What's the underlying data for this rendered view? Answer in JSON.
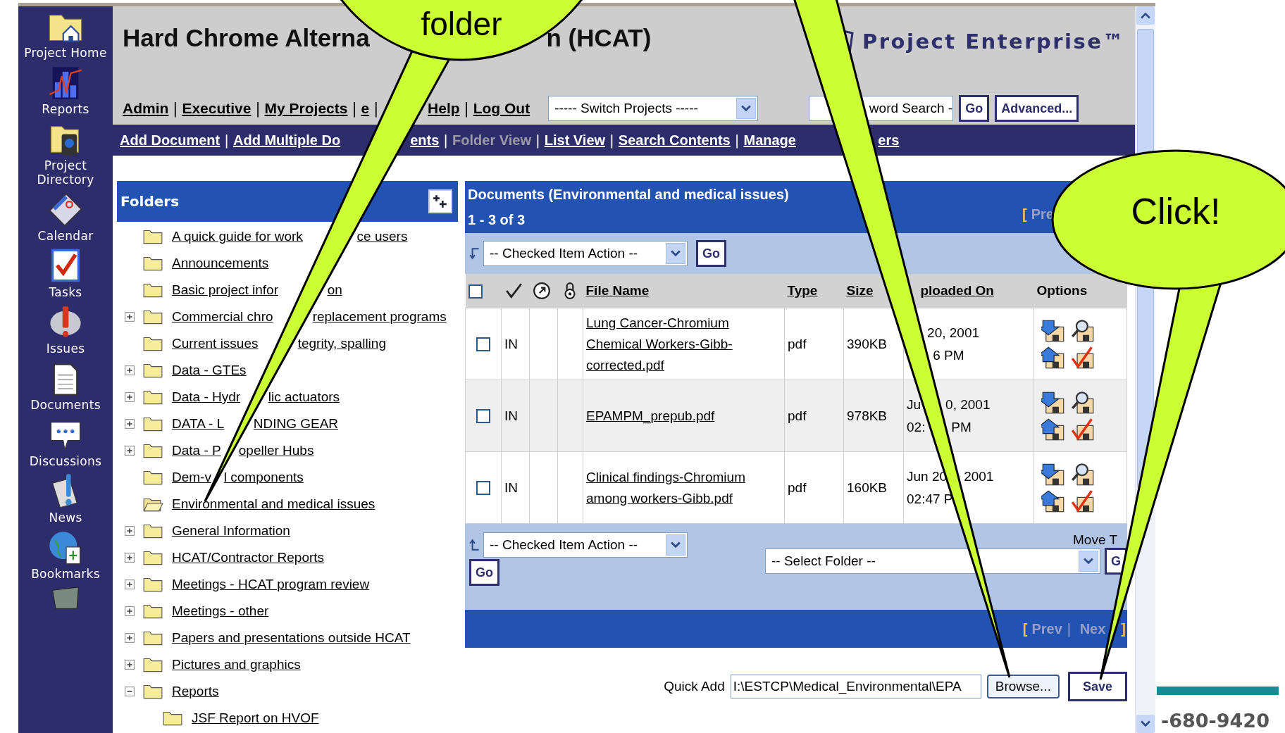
{
  "sidebar": {
    "items": [
      {
        "kind": "home",
        "label": "Project Home"
      },
      {
        "kind": "reports",
        "label": "Reports"
      },
      {
        "kind": "directory",
        "label": "Project Directory"
      },
      {
        "kind": "calendar",
        "label": "Calendar"
      },
      {
        "kind": "tasks",
        "label": "Tasks"
      },
      {
        "kind": "issues",
        "label": "Issues"
      },
      {
        "kind": "documents",
        "label": "Documents"
      },
      {
        "kind": "discussions",
        "label": "Discussions"
      },
      {
        "kind": "news",
        "label": "News"
      },
      {
        "kind": "bookmarks",
        "label": "Bookmarks"
      },
      {
        "kind": "box"
      }
    ]
  },
  "header": {
    "title_parts": [
      "Hard Chrome Alterna",
      "n (HCAT)"
    ],
    "logo": "Project Enterprise™",
    "nav_separator": "|",
    "nav_links": [
      {
        "label": "Admin"
      },
      {
        "label": "Executive"
      },
      {
        "label": "My Projects"
      },
      {
        "label": "e"
      },
      {
        "label": "Help"
      },
      {
        "label": "Log Out"
      }
    ],
    "switch_projects": "----- Switch Projects -----",
    "keyword_search": "word Search -",
    "go": "Go",
    "advanced": "Advanced..."
  },
  "subnav": {
    "separator": "|",
    "links": [
      {
        "parts": [
          "Add Document"
        ],
        "selected": false
      },
      {
        "parts": [
          "Add Multiple Do",
          "ents"
        ],
        "selected": false
      },
      {
        "parts": [
          "Folder View"
        ],
        "selected": true
      },
      {
        "parts": [
          "List View"
        ],
        "selected": false
      },
      {
        "parts": [
          "Search Contents"
        ],
        "selected": false
      },
      {
        "parts": [
          "Manage",
          "ers"
        ],
        "selected": false
      }
    ]
  },
  "folders": {
    "title": "Folders",
    "items": [
      {
        "parts": [
          "A quick guide for work",
          "ce users"
        ],
        "expandable": false,
        "selected": false
      },
      {
        "parts": [
          "Announcements"
        ],
        "expandable": false,
        "selected": false
      },
      {
        "parts": [
          "Basic project infor",
          "on"
        ],
        "expandable": false,
        "selected": false
      },
      {
        "parts": [
          "Commercial chro",
          "replacement programs"
        ],
        "expandable": true,
        "expanded": false,
        "selected": false
      },
      {
        "parts": [
          "Current issues",
          "tegrity, spalling"
        ],
        "expandable": false,
        "selected": false
      },
      {
        "parts": [
          "Data - GTEs"
        ],
        "expandable": true,
        "expanded": false,
        "selected": false
      },
      {
        "parts": [
          "Data - Hydr",
          "lic actuators"
        ],
        "expandable": true,
        "expanded": false,
        "selected": false
      },
      {
        "parts": [
          "DATA - L",
          "NDING GEAR"
        ],
        "expandable": true,
        "expanded": false,
        "selected": false
      },
      {
        "parts": [
          "Data - P",
          "opeller Hubs"
        ],
        "expandable": true,
        "expanded": false,
        "selected": false
      },
      {
        "parts": [
          "Dem-v",
          "l components"
        ],
        "expandable": false,
        "selected": false
      },
      {
        "parts": [
          "Environmental and medical issues"
        ],
        "expandable": false,
        "selected": true
      },
      {
        "parts": [
          "General Information"
        ],
        "expandable": true,
        "expanded": false,
        "selected": false
      },
      {
        "parts": [
          "HCAT/Contractor Reports"
        ],
        "expandable": true,
        "expanded": false,
        "selected": false
      },
      {
        "parts": [
          "Meetings - HCAT program review"
        ],
        "expandable": true,
        "expanded": false,
        "selected": false
      },
      {
        "parts": [
          "Meetings - other"
        ],
        "expandable": true,
        "expanded": false,
        "selected": false
      },
      {
        "parts": [
          "Papers and presentations outside HCAT"
        ],
        "expandable": true,
        "expanded": false,
        "selected": false
      },
      {
        "parts": [
          "Pictures and graphics"
        ],
        "expandable": true,
        "expanded": false,
        "selected": false
      },
      {
        "parts": [
          "Reports"
        ],
        "expandable": true,
        "expanded": true,
        "selected": false,
        "children": [
          {
            "parts": [
              "JSF Report on HVOF"
            ],
            "expandable": false,
            "selected": false
          }
        ]
      }
    ]
  },
  "documents": {
    "title": "Documents (Environmental and medical issues) 1 - 3 of 3",
    "pager_top": {
      "open": "[",
      "prev": "Pre"
    },
    "action_select": "-- Checked Item Action --",
    "go": "Go",
    "columns": [
      {
        "kind": "select_all",
        "checked": false
      },
      {
        "kind": "icon"
      },
      {
        "kind": "icon"
      },
      {
        "kind": "icon"
      },
      {
        "kind": "text",
        "label": "File Name",
        "sortable": true,
        "covered_before": false
      },
      {
        "kind": "text",
        "label": "Type",
        "sortable": true,
        "covered_before": false
      },
      {
        "kind": "text",
        "label": "Size",
        "sortable": true,
        "covered_before": false
      },
      {
        "kind": "text",
        "label": "ploaded On",
        "sortable": true,
        "covered_before": true
      },
      {
        "kind": "text",
        "label": "Options",
        "sortable": false,
        "covered_before": false
      }
    ],
    "rows": [
      {
        "checked": false,
        "status": "IN",
        "file": "Lung Cancer-Chromium Chemical Workers-Gibb-corrected.pdf",
        "type": "pdf",
        "size": "390KB",
        "uploaded": [
          {
            "parts": [
              "20, 2001"
            ],
            "lead_covered": true
          },
          {
            "parts": [
              "6 PM"
            ],
            "lead_covered": true
          }
        ]
      },
      {
        "checked": false,
        "status": "IN",
        "file": "EPAMPM_prepub.pdf",
        "type": "pdf",
        "size": "978KB",
        "uploaded": [
          {
            "parts": [
              "Ju",
              "0, 2001"
            ],
            "lead_covered": false
          },
          {
            "parts": [
              "02:",
              "PM"
            ],
            "lead_covered": false
          }
        ]
      },
      {
        "checked": false,
        "status": "IN",
        "file": "Clinical findings-Chromium among workers-Gibb.pdf",
        "type": "pdf",
        "size": "160KB",
        "uploaded": [
          {
            "parts": [
              "Jun 20",
              "2001"
            ],
            "lead_covered": false
          },
          {
            "parts": [
              "02:47 P"
            ],
            "lead_covered": false
          }
        ]
      }
    ],
    "bottom_action_select": "-- Checked Item Action --",
    "bottom_go": "Go",
    "move_label": "Move T",
    "folder_select": "-- Select Folder --",
    "move_go": "G",
    "pager_bottom": {
      "open": "[",
      "prev": "Prev",
      "sep": "|",
      "next": "Nex",
      "close": "]"
    },
    "quick_add": {
      "label": "Quick Add",
      "value": "I:\\ESTCP\\Medical_Environmental\\EPA",
      "browse": "Browse...",
      "save": "Save"
    }
  },
  "callouts": [
    {
      "kind": "bubble",
      "text": "folder"
    },
    {
      "kind": "pointer"
    },
    {
      "kind": "bubble",
      "text": "Click!"
    }
  ],
  "slide": {
    "phone": "-680-9420"
  }
}
